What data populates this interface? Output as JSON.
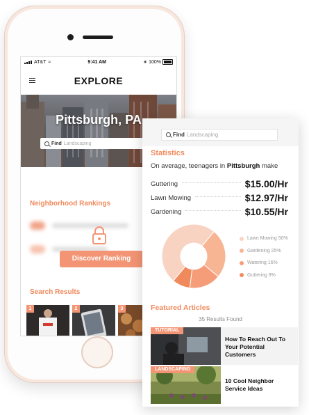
{
  "phone": {
    "status": {
      "carrier": "AT&T",
      "time": "9:41 AM",
      "battery": "100%"
    },
    "app_title": "EXPLORE",
    "hero": {
      "city": "Pittsburgh, PA"
    },
    "search": {
      "label": "Find",
      "placeholder": "Landscaping"
    },
    "rankings": {
      "title": "Neighborhood Rankings",
      "button": "Discover Ranking"
    },
    "results": {
      "title": "Search Results",
      "thumbs": [
        "1",
        "2",
        "3"
      ]
    }
  },
  "card": {
    "search": {
      "label": "Find",
      "placeholder": "Landscaping"
    },
    "stats": {
      "title": "Statistics",
      "subtitle_prefix": "On average, teenagers in",
      "subtitle_city": "Pittsburgh",
      "subtitle_suffix": "make",
      "rates": [
        {
          "label": "Guttering",
          "value": "$15.00/Hr"
        },
        {
          "label": "Lawn Mowing",
          "value": "$12.97/Hr"
        },
        {
          "label": "Gardening",
          "value": "$10.55/Hr"
        }
      ]
    },
    "featured": {
      "title": "Featured Articles",
      "count": "35 Results Found",
      "articles": [
        {
          "tag": "TUTORIAL",
          "title": "How To Reach Out To Your Potential Customers"
        },
        {
          "tag": "LANDSCAPING",
          "title": "10 Cool Neighbor Service Ideas"
        }
      ]
    }
  },
  "chart_data": {
    "type": "pie",
    "categories": [
      "Lawn Mowing",
      "Gardening",
      "Watering",
      "Guttering"
    ],
    "labels": [
      "Lawn Mowing 50%",
      "Gardening 25%",
      "Watering 16%",
      "Guttering 9%"
    ],
    "values": [
      50,
      25,
      16,
      9
    ],
    "colors": [
      "#f9d3c2",
      "#f7b594",
      "#f59c78",
      "#f08a5d"
    ]
  }
}
